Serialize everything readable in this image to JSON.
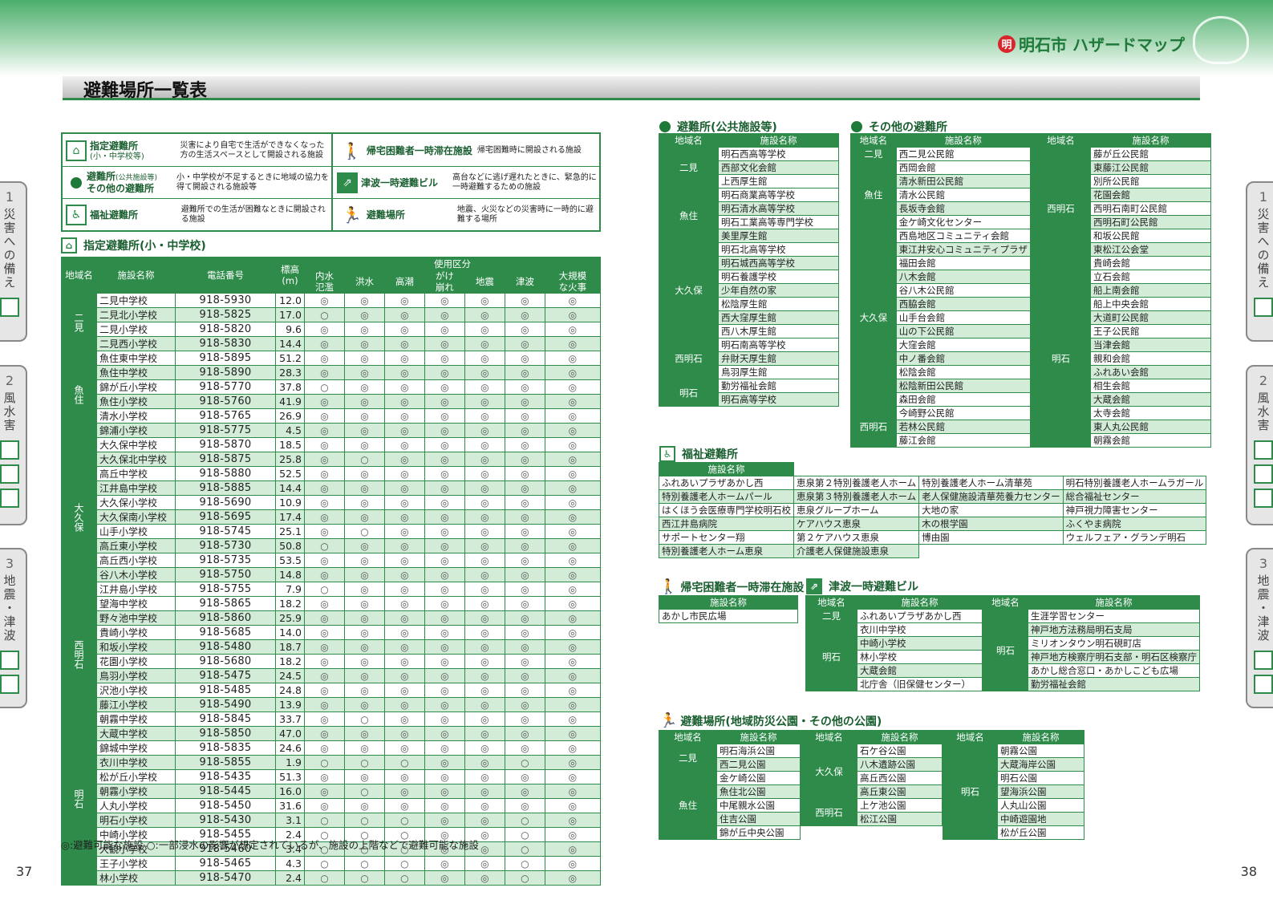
{
  "brand": {
    "logo": "明",
    "text": "明石市 ハザードマップ"
  },
  "page_title": "避難場所一覧表",
  "tabs": {
    "t1": {
      "num": "1",
      "label": "災害への備え"
    },
    "t2": {
      "num": "2",
      "label": "風水害"
    },
    "t3": {
      "num": "3",
      "label": "地震・津波"
    }
  },
  "page_numbers": {
    "left": "37",
    "right": "38"
  },
  "legend": [
    {
      "icon": "shelter-icon",
      "title": "指定避難所",
      "sub": "(小・中学校等)",
      "desc": "災害により自宅で生活ができなくなった方の生活スペースとして開設される施設"
    },
    {
      "icon": "dot-icon",
      "title": "避難所",
      "title_small": "(公共施設等)",
      "title2": "その他の避難所",
      "desc": "小・中学校が不足するときに地域の協力を得て開設される施設等"
    },
    {
      "icon": "welfare-icon",
      "title": "福祉避難所",
      "desc": "避難所での生活が困難なときに開設される施設"
    },
    {
      "icon": "walker-icon",
      "title": "帰宅困難者一時滞在施設",
      "desc": "帰宅困難時に開設される施設"
    },
    {
      "icon": "tsunami-building-icon",
      "title": "津波一時避難ビル",
      "desc": "高台などに逃げ遅れたときに、緊急的に一時避難するための施設"
    },
    {
      "icon": "evac-place-icon",
      "title": "避難場所",
      "desc": "地震、火災などの災害時に一時的に避難する場所"
    }
  ],
  "schools": {
    "title": "指定避難所(小・中学校)",
    "headers": {
      "area": "地域名",
      "name": "施設名称",
      "tel": "電話番号",
      "elev": "標高",
      "elev_unit": "(m)",
      "usage": "使用区分"
    },
    "usage_cols": [
      [
        "内水",
        "氾濫"
      ],
      [
        "洪水"
      ],
      [
        "高潮"
      ],
      [
        "がけ",
        "崩れ"
      ],
      [
        "地震"
      ],
      [
        "津波"
      ],
      [
        "大規模",
        "な火事"
      ]
    ],
    "groups": [
      {
        "area": "二見",
        "rows": [
          [
            "二見中学校",
            "918-5930",
            "12.0",
            "◎",
            "◎",
            "◎",
            "◎",
            "◎",
            "◎",
            "◎"
          ],
          [
            "二見北小学校",
            "918-5825",
            "17.0",
            "○",
            "◎",
            "◎",
            "◎",
            "◎",
            "◎",
            "◎"
          ],
          [
            "二見小学校",
            "918-5820",
            "9.6",
            "◎",
            "◎",
            "◎",
            "◎",
            "◎",
            "◎",
            "◎"
          ],
          [
            "二見西小学校",
            "918-5830",
            "14.4",
            "◎",
            "◎",
            "◎",
            "◎",
            "◎",
            "◎",
            "◎"
          ]
        ]
      },
      {
        "area": "魚住",
        "rows": [
          [
            "魚住東中学校",
            "918-5895",
            "51.2",
            "◎",
            "◎",
            "◎",
            "◎",
            "◎",
            "◎",
            "◎"
          ],
          [
            "魚住中学校",
            "918-5890",
            "28.3",
            "◎",
            "◎",
            "◎",
            "◎",
            "◎",
            "◎",
            "◎"
          ],
          [
            "錦が丘小学校",
            "918-5770",
            "37.8",
            "○",
            "◎",
            "◎",
            "◎",
            "◎",
            "◎",
            "◎"
          ],
          [
            "魚住小学校",
            "918-5760",
            "41.9",
            "◎",
            "◎",
            "◎",
            "◎",
            "◎",
            "◎",
            "◎"
          ],
          [
            "清水小学校",
            "918-5765",
            "26.9",
            "◎",
            "◎",
            "◎",
            "◎",
            "◎",
            "◎",
            "◎"
          ],
          [
            "錦浦小学校",
            "918-5775",
            "4.5",
            "◎",
            "◎",
            "◎",
            "◎",
            "◎",
            "◎",
            "◎"
          ]
        ]
      },
      {
        "area": "大久保",
        "rows": [
          [
            "大久保中学校",
            "918-5870",
            "18.5",
            "◎",
            "◎",
            "◎",
            "◎",
            "◎",
            "◎",
            "◎"
          ],
          [
            "大久保北中学校",
            "918-5875",
            "25.8",
            "◎",
            "○",
            "◎",
            "◎",
            "◎",
            "◎",
            "◎"
          ],
          [
            "高丘中学校",
            "918-5880",
            "52.5",
            "◎",
            "◎",
            "◎",
            "◎",
            "◎",
            "◎",
            "◎"
          ],
          [
            "江井島中学校",
            "918-5885",
            "14.4",
            "◎",
            "◎",
            "◎",
            "◎",
            "◎",
            "◎",
            "◎"
          ],
          [
            "大久保小学校",
            "918-5690",
            "10.9",
            "◎",
            "◎",
            "◎",
            "◎",
            "◎",
            "◎",
            "◎"
          ],
          [
            "大久保南小学校",
            "918-5695",
            "17.4",
            "◎",
            "◎",
            "◎",
            "◎",
            "◎",
            "◎",
            "◎"
          ],
          [
            "山手小学校",
            "918-5745",
            "25.1",
            "◎",
            "○",
            "◎",
            "◎",
            "◎",
            "◎",
            "◎"
          ],
          [
            "高丘東小学校",
            "918-5730",
            "50.8",
            "○",
            "◎",
            "◎",
            "◎",
            "◎",
            "◎",
            "◎"
          ],
          [
            "高丘西小学校",
            "918-5735",
            "53.5",
            "◎",
            "◎",
            "◎",
            "◎",
            "◎",
            "◎",
            "◎"
          ],
          [
            "谷八木小学校",
            "918-5750",
            "14.8",
            "◎",
            "◎",
            "◎",
            "◎",
            "◎",
            "◎",
            "◎"
          ],
          [
            "江井島小学校",
            "918-5755",
            "7.9",
            "○",
            "◎",
            "◎",
            "◎",
            "◎",
            "◎",
            "◎"
          ]
        ]
      },
      {
        "area": "西明石",
        "rows": [
          [
            "望海中学校",
            "918-5865",
            "18.2",
            "◎",
            "◎",
            "◎",
            "◎",
            "◎",
            "◎",
            "◎"
          ],
          [
            "野々池中学校",
            "918-5860",
            "25.9",
            "◎",
            "◎",
            "◎",
            "◎",
            "◎",
            "◎",
            "◎"
          ],
          [
            "貴崎小学校",
            "918-5685",
            "14.0",
            "◎",
            "◎",
            "◎",
            "◎",
            "◎",
            "◎",
            "◎"
          ],
          [
            "和坂小学校",
            "918-5480",
            "18.7",
            "◎",
            "◎",
            "◎",
            "◎",
            "◎",
            "◎",
            "◎"
          ],
          [
            "花園小学校",
            "918-5680",
            "18.2",
            "◎",
            "◎",
            "◎",
            "◎",
            "◎",
            "◎",
            "◎"
          ],
          [
            "鳥羽小学校",
            "918-5475",
            "24.5",
            "◎",
            "◎",
            "◎",
            "◎",
            "◎",
            "◎",
            "◎"
          ],
          [
            "沢池小学校",
            "918-5485",
            "24.8",
            "◎",
            "◎",
            "◎",
            "◎",
            "◎",
            "◎",
            "◎"
          ],
          [
            "藤江小学校",
            "918-5490",
            "13.9",
            "◎",
            "◎",
            "◎",
            "◎",
            "◎",
            "◎",
            "◎"
          ]
        ]
      },
      {
        "area": "明石",
        "rows": [
          [
            "朝霧中学校",
            "918-5845",
            "33.7",
            "◎",
            "○",
            "◎",
            "◎",
            "◎",
            "◎",
            "◎"
          ],
          [
            "大蔵中学校",
            "918-5850",
            "47.0",
            "◎",
            "◎",
            "◎",
            "◎",
            "◎",
            "◎",
            "◎"
          ],
          [
            "錦城中学校",
            "918-5835",
            "24.6",
            "◎",
            "◎",
            "◎",
            "◎",
            "◎",
            "◎",
            "◎"
          ],
          [
            "衣川中学校",
            "918-5855",
            "1.9",
            "○",
            "○",
            "○",
            "◎",
            "◎",
            "○",
            "◎"
          ],
          [
            "松が丘小学校",
            "918-5435",
            "51.3",
            "◎",
            "◎",
            "◎",
            "◎",
            "◎",
            "◎",
            "◎"
          ],
          [
            "朝霧小学校",
            "918-5445",
            "16.0",
            "◎",
            "○",
            "◎",
            "◎",
            "◎",
            "◎",
            "◎"
          ],
          [
            "人丸小学校",
            "918-5450",
            "31.6",
            "◎",
            "◎",
            "◎",
            "◎",
            "◎",
            "◎",
            "◎"
          ],
          [
            "明石小学校",
            "918-5430",
            "3.1",
            "○",
            "○",
            "○",
            "◎",
            "◎",
            "○",
            "◎"
          ],
          [
            "中崎小学校",
            "918-5455",
            "2.4",
            "○",
            "○",
            "○",
            "◎",
            "◎",
            "○",
            "◎"
          ],
          [
            "大観小学校",
            "918-5460",
            "3.4",
            "○",
            "○",
            "○",
            "◎",
            "◎",
            "○",
            "◎"
          ],
          [
            "王子小学校",
            "918-5465",
            "4.3",
            "○",
            "○",
            "○",
            "◎",
            "◎",
            "○",
            "◎"
          ],
          [
            "林小学校",
            "918-5470",
            "2.4",
            "○",
            "○",
            "○",
            "◎",
            "◎",
            "○",
            "◎"
          ]
        ]
      }
    ],
    "note": "◎:避難可能な施設  ○:一部浸水の影響が想定されているが、施設の上階などで避難可能な施設"
  },
  "public": {
    "title": "避難所(公共施設等)",
    "headers": {
      "area": "地域名",
      "name": "施設名称"
    },
    "groups": [
      {
        "area": "二見",
        "items": [
          "明石西高等学校",
          "西部文化会館",
          "上西厚生館"
        ]
      },
      {
        "area": "魚住",
        "items": [
          "明石商業高等学校",
          "明石清水高等学校",
          "明石工業高等専門学校",
          "美里厚生館"
        ]
      },
      {
        "area": "大久保",
        "items": [
          "明石北高等学校",
          "明石城西高等学校",
          "明石養護学校",
          "少年自然の家",
          "松陰厚生館",
          "西大窪厚生館",
          "西八木厚生館"
        ]
      },
      {
        "area": "西明石",
        "items": [
          "明石南高等学校",
          "弁財天厚生館",
          "鳥羽厚生館"
        ]
      },
      {
        "area": "明石",
        "items": [
          "勤労福祉会館",
          "明石高等学校"
        ]
      }
    ]
  },
  "other": {
    "title": "その他の避難所",
    "headers": {
      "area": "地域名",
      "name": "施設名称"
    },
    "left": [
      {
        "area": "二見",
        "items": [
          "西二見公民館"
        ]
      },
      {
        "area": "魚住",
        "items": [
          "西岡会館",
          "清水新田公民館",
          "清水公民館",
          "長坂寺会館",
          "金ケ崎文化センター"
        ]
      },
      {
        "area": "大久保",
        "items": [
          "西島地区コミュニティ会館",
          "東江井安心コミュニティプラザ",
          "福田会館",
          "八木会館",
          "谷八木公民館",
          "西脇会館",
          "山手台会館",
          "山の下公民館",
          "大窪会館",
          "中ノ番会館",
          "松陰会館",
          "松陰新田公民館",
          "森田会館"
        ]
      },
      {
        "area": "西明石",
        "items": [
          "今崎野公民館",
          "若林公民館",
          "藤江会館"
        ]
      }
    ],
    "right": [
      {
        "area": "西明石",
        "items": [
          "藤が丘公民館",
          "東藤江公民館",
          "別所公民館",
          "花園会館",
          "西明石南町公民館",
          "西明石町公民館",
          "和坂公民館",
          "東松江公会堂",
          "貴崎会館"
        ]
      },
      {
        "area": "明石",
        "items": [
          "立石会館",
          "船上南会館",
          "船上中央会館",
          "大道町公民館",
          "王子公民館",
          "当津会館",
          "親和会館",
          "ふれあい会館",
          "相生会館",
          "大蔵会館",
          "太寺会館",
          "東人丸公民館",
          "朝霧会館"
        ]
      }
    ]
  },
  "welfare": {
    "title": "福祉避難所",
    "header": "施設名称",
    "cols": [
      [
        "ふれあいプラザあかし西",
        "特別養護老人ホームパール",
        "はくほう会医療専門学校明石校",
        "西江井島病院",
        "サポートセンター翔",
        "特別養護老人ホーム恵泉"
      ],
      [
        "恵泉第２特別養護老人ホーム",
        "恵泉第３特別養護老人ホーム",
        "恵泉グループホーム",
        "ケアハウス恵泉",
        "第２ケアハウス恵泉",
        "介護老人保健施設恵泉"
      ],
      [
        "特別養護老人ホーム清華苑",
        "老人保健施設清華苑養力センター",
        "大地の家",
        "木の根学園",
        "博由園"
      ],
      [
        "明石特別養護老人ホームラガール",
        "総合福祉センター",
        "神戸視力障害センター",
        "ふくやま病院",
        "ウェルフェア・グランデ明石"
      ]
    ]
  },
  "stranded": {
    "title": "帰宅困難者一時滞在施設",
    "header": "施設名称",
    "items": [
      "あかし市民広場"
    ]
  },
  "tsunami": {
    "title": "津波一時避難ビル",
    "headers": {
      "area": "地域名",
      "name": "施設名称"
    },
    "left": [
      {
        "area": "二見",
        "items": [
          "ふれあいプラザあかし西"
        ]
      },
      {
        "area": "明石",
        "items": [
          "衣川中学校",
          "中崎小学校",
          "林小学校",
          "大蔵会館",
          "北庁舎（旧保健センター）"
        ]
      }
    ],
    "right": [
      {
        "area": "明石",
        "items": [
          "生涯学習センター",
          "神戸地方法務局明石支局",
          "ミリオンタウン明石硯町店",
          "神戸地方検察庁明石支部・明石区検察庁",
          "あかし総合窓口・あかしこども広場",
          "勤労福祉会館"
        ]
      }
    ]
  },
  "parks": {
    "title": "避難場所(地域防災公園・その他の公園)",
    "headers": {
      "area": "地域名",
      "name": "施設名称"
    },
    "c1": [
      {
        "area": "二見",
        "items": [
          "明石海浜公園",
          "西二見公園"
        ]
      },
      {
        "area": "魚住",
        "items": [
          "金ケ崎公園",
          "魚住北公園",
          "中尾親水公園",
          "住吉公園",
          "錦が丘中央公園"
        ]
      }
    ],
    "c2": [
      {
        "area": "大久保",
        "items": [
          "石ケ谷公園",
          "八木遺跡公園",
          "高丘西公園",
          "高丘東公園"
        ]
      },
      {
        "area": "西明石",
        "items": [
          "上ケ池公園",
          "松江公園"
        ]
      }
    ],
    "c3": [
      {
        "area": "明石",
        "items": [
          "朝霧公園",
          "大蔵海岸公園",
          "明石公園",
          "望海浜公園",
          "人丸山公園",
          "中崎遊園地",
          "松が丘公園"
        ]
      }
    ]
  }
}
